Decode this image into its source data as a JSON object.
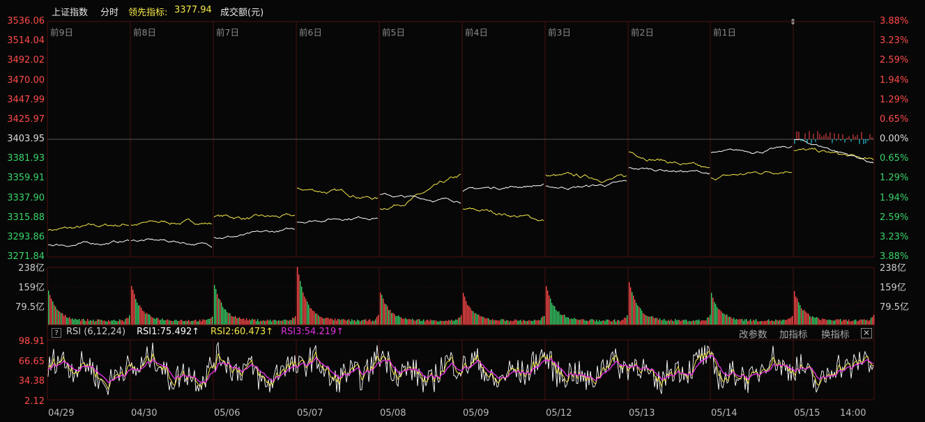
{
  "header": {
    "index_name": "上证指数",
    "mode": "分时",
    "leader_label": "领先指标:",
    "leader_value": "3377.94",
    "volume_label": "成交额(元)"
  },
  "colors": {
    "up": "#ff4a4a",
    "down": "#3ad36a",
    "price": "#ffffff",
    "leader": "#f5e84a",
    "grid": "#3a0d0d",
    "rsi1": "#ffffff",
    "rsi2": "#f5e84a",
    "rsi3": "#e032e0",
    "cyan": "#2ee8ff"
  },
  "price_axis": {
    "left_ticks": [
      "3536.06",
      "3514.04",
      "3492.02",
      "3470.00",
      "3447.99",
      "3425.97",
      "3403.95",
      "3381.93",
      "3359.91",
      "3337.90",
      "3315.88",
      "3293.86",
      "3271.84"
    ],
    "right_ticks": [
      "3.88%",
      "3.23%",
      "2.59%",
      "1.94%",
      "1.29%",
      "0.65%",
      "0.00%",
      "0.65%",
      "1.29%",
      "1.94%",
      "2.59%",
      "3.23%",
      "3.88%"
    ],
    "min": 3271.84,
    "max": 3536.06,
    "prev_close": 3403.95
  },
  "day_labels": [
    "前9日",
    "前8日",
    "前7日",
    "前6日",
    "前5日",
    "前4日",
    "前3日",
    "前2日",
    "前1日"
  ],
  "volume_axis": {
    "left_ticks": [
      "238亿",
      "159亿",
      "79.5亿"
    ],
    "right_ticks": [
      "238亿",
      "159亿",
      "79.5亿"
    ],
    "max": 238
  },
  "rsi": {
    "help": "?",
    "params": "RSI (6,12,24)",
    "rsi1_label": "RSI1:75.492↑",
    "rsi2_label": "RSI2:60.473↑",
    "rsi3_label": "RSI3:54.219↑",
    "ticks": [
      "98.91",
      "66.65",
      "34.38",
      "2.12"
    ],
    "min": 2.12,
    "max": 98.91
  },
  "toolbar": {
    "change_params": "改参数",
    "add_indicator": "加指标",
    "switch_indicator": "换指标",
    "close": "✕"
  },
  "dates": [
    "04/29",
    "04/30",
    "05/06",
    "05/07",
    "05/08",
    "05/09",
    "05/12",
    "05/13",
    "05/14",
    "05/15",
    "14:00"
  ],
  "chart_data": {
    "type": "line",
    "title": "上证指数 分时",
    "series": [
      {
        "name": "上证指数",
        "kind": "price_daily_points",
        "start": [
          3286,
          3291,
          3294,
          3312,
          3341,
          3345,
          3350,
          3371,
          3388,
          3404
        ],
        "end": [
          3290,
          3285,
          3302,
          3318,
          3336,
          3353,
          3355,
          3366,
          3395,
          3378
        ]
      },
      {
        "name": "领先指标",
        "kind": "leader_daily_points",
        "start": [
          3303,
          3308,
          3318,
          3348,
          3326,
          3325,
          3363,
          3390,
          3362,
          3392
        ],
        "end": [
          3309,
          3310,
          3316,
          3338,
          3361,
          3313,
          3361,
          3367,
          3372,
          3378
        ]
      }
    ],
    "volume_peaks": [
      120,
      145,
      150,
      222,
      120,
      110,
      140,
      160,
      110,
      120
    ],
    "ylim": [
      3271.84,
      3536.06
    ]
  }
}
